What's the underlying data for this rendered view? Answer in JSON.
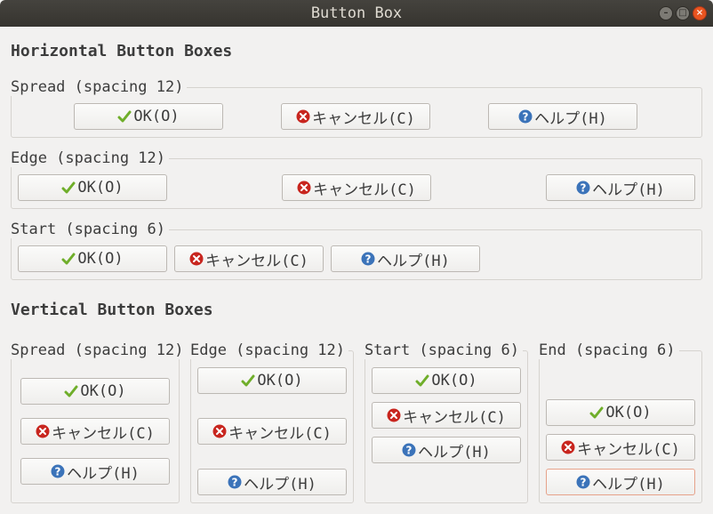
{
  "window": {
    "title": "Button Box"
  },
  "horizontal": {
    "heading": "Horizontal Button Boxes",
    "frames": [
      {
        "label": "Spread (spacing 12)"
      },
      {
        "label": "Edge (spacing 12)"
      },
      {
        "label": "Start (spacing 6)"
      }
    ]
  },
  "vertical": {
    "heading": "Vertical Button Boxes",
    "frames": [
      {
        "label": "Spread (spacing 12)"
      },
      {
        "label": "Edge (spacing 12)"
      },
      {
        "label": "Start (spacing 6)"
      },
      {
        "label": "End (spacing 6)"
      }
    ]
  },
  "buttons": {
    "ok": "OK(O)",
    "cancel": "キャンセル(C)",
    "help": "ヘルプ(H)"
  },
  "icons": {
    "ok": "check-icon",
    "cancel": "cancel-icon",
    "help": "help-icon"
  },
  "colors": {
    "titlebar": "#3c3b37",
    "check": "#6fae2a",
    "cancel": "#c8261f",
    "help": "#3b73b9",
    "focus": "#e6a28a"
  }
}
